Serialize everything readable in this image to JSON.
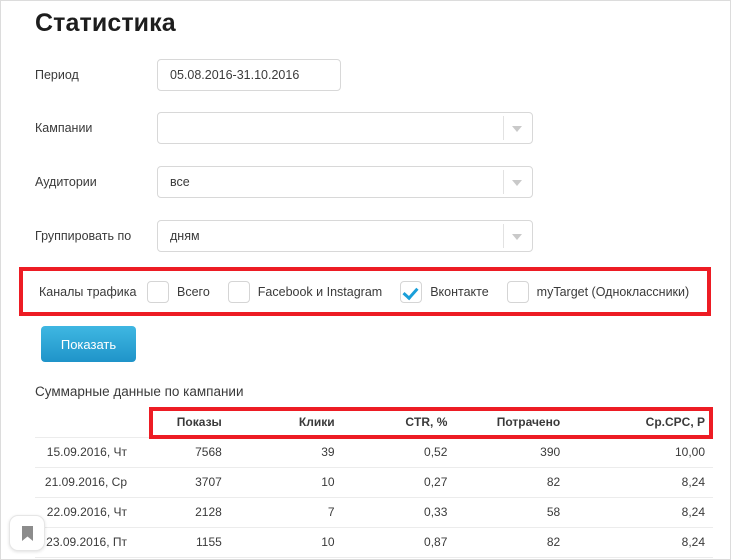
{
  "page": {
    "title": "Статистика"
  },
  "form": {
    "rows": [
      {
        "label": "Период",
        "value": "05.08.2016-31.10.2016",
        "type": "text"
      },
      {
        "label": "Кампании",
        "value": "",
        "type": "select"
      },
      {
        "label": "Аудитории",
        "value": "все",
        "type": "select"
      },
      {
        "label": "Группировать по",
        "value": "дням",
        "type": "select"
      }
    ]
  },
  "channels": {
    "label": "Каналы трафика",
    "items": [
      {
        "label": "Всего",
        "checked": false
      },
      {
        "label": "Facebook и Instagram",
        "checked": false
      },
      {
        "label": "Вконтакте",
        "checked": true
      },
      {
        "label": "myTarget (Одноклассники)",
        "checked": false
      }
    ],
    "highlight_color": "#ed1c24"
  },
  "actions": {
    "show_label": "Показать",
    "button_color": "#2ba3d4"
  },
  "report": {
    "section_title": "Суммарные данные по кампании",
    "columns": [
      "",
      "Показы",
      "Клики",
      "CTR, %",
      "Потрачено",
      "Ср.CPC, Р"
    ],
    "rows": [
      {
        "date": "15.09.2016, Чт",
        "impressions": "7568",
        "clicks": "39",
        "ctr": "0,52",
        "spent": "390",
        "cpc": "10,00"
      },
      {
        "date": "21.09.2016, Ср",
        "impressions": "3707",
        "clicks": "10",
        "ctr": "0,27",
        "spent": "82",
        "cpc": "8,24"
      },
      {
        "date": "22.09.2016, Чт",
        "impressions": "2128",
        "clicks": "7",
        "ctr": "0,33",
        "spent": "58",
        "cpc": "8,24"
      },
      {
        "date": "23.09.2016, Пт",
        "impressions": "1155",
        "clicks": "10",
        "ctr": "0,87",
        "spent": "82",
        "cpc": "8,24"
      }
    ],
    "highlight_color": "#ed1c24"
  },
  "bookmark": {
    "icon": "bookmark-icon"
  }
}
